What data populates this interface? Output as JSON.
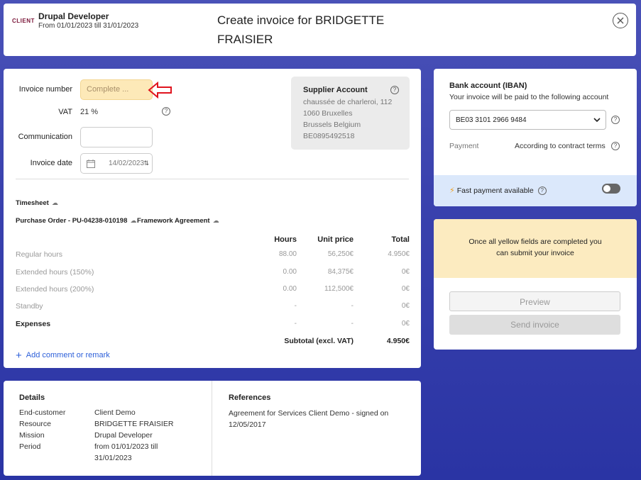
{
  "header": {
    "client_logo": "CLIENT",
    "mission_title": "Drupal Developer",
    "mission_period": "From 01/01/2023 till 31/01/2023",
    "page_title": "Create invoice for BRIDGETTE FRAISIER",
    "close_icon": "close-circle-icon"
  },
  "form": {
    "invoice_number_label": "Invoice number",
    "invoice_number_placeholder": "Complete ...",
    "vat_label": "VAT",
    "vat_value": "21 %",
    "communication_label": "Communication",
    "communication_value": "",
    "invoice_date_label": "Invoice date",
    "invoice_date_value": "14/02/2023"
  },
  "supplier": {
    "title": "Supplier Account",
    "address_line1": "chaussée de charleroi, 112",
    "address_line2": "1060 Bruxelles",
    "address_line3": "Brussels Belgium",
    "vat_number": "BE0895492518"
  },
  "documents": {
    "timesheet": "Timesheet",
    "purchase_order": "Purchase Order - PU-04238-010198",
    "framework": "Framework Agreement"
  },
  "table": {
    "headers": {
      "hours": "Hours",
      "unit_price": "Unit price",
      "total": "Total"
    },
    "rows": [
      {
        "label": "Regular hours",
        "hours": "88.00",
        "unit_price": "56,250€",
        "total": "4.950€"
      },
      {
        "label": "Extended hours (150%)",
        "hours": "0.00",
        "unit_price": "84,375€",
        "total": "0€"
      },
      {
        "label": "Extended hours (200%)",
        "hours": "0.00",
        "unit_price": "112,500€",
        "total": "0€"
      },
      {
        "label": "Standby",
        "hours": "-",
        "unit_price": "-",
        "total": "0€"
      },
      {
        "label": "Expenses",
        "hours": "-",
        "unit_price": "-",
        "total": "0€"
      }
    ],
    "subtotal_label": "Subtotal (excl. VAT)",
    "subtotal_value": "4.950€"
  },
  "add_comment_label": "Add comment or remark",
  "bank": {
    "title": "Bank account (IBAN)",
    "subtitle": "Your invoice will be paid to the following account",
    "iban": "BE03 3101 2966 9484",
    "payment_label": "Payment",
    "payment_value": "According to contract terms",
    "fast_payment_label": "Fast payment available",
    "fast_payment_enabled": false
  },
  "submit": {
    "note": "Once all yellow fields are completed you can submit your invoice",
    "preview_label": "Preview",
    "send_label": "Send invoice"
  },
  "details": {
    "title": "Details",
    "end_customer_label": "End-customer",
    "end_customer_value": "Client Demo",
    "resource_label": "Resource",
    "resource_value": "BRIDGETTE FRAISIER",
    "mission_label": "Mission",
    "mission_value": "Drupal Developer",
    "period_label": "Period",
    "period_value_line1": "from 01/01/2023 till",
    "period_value_line2": "31/01/2023"
  },
  "references": {
    "title": "References",
    "text": "Agreement for Services Client Demo - signed on 12/05/2017"
  },
  "colors": {
    "background": "#3a42ae",
    "required_field": "#fde9b8",
    "link": "#2c5fd9",
    "fast_bar": "#dbe8fb",
    "annotation": "#e0141e"
  }
}
